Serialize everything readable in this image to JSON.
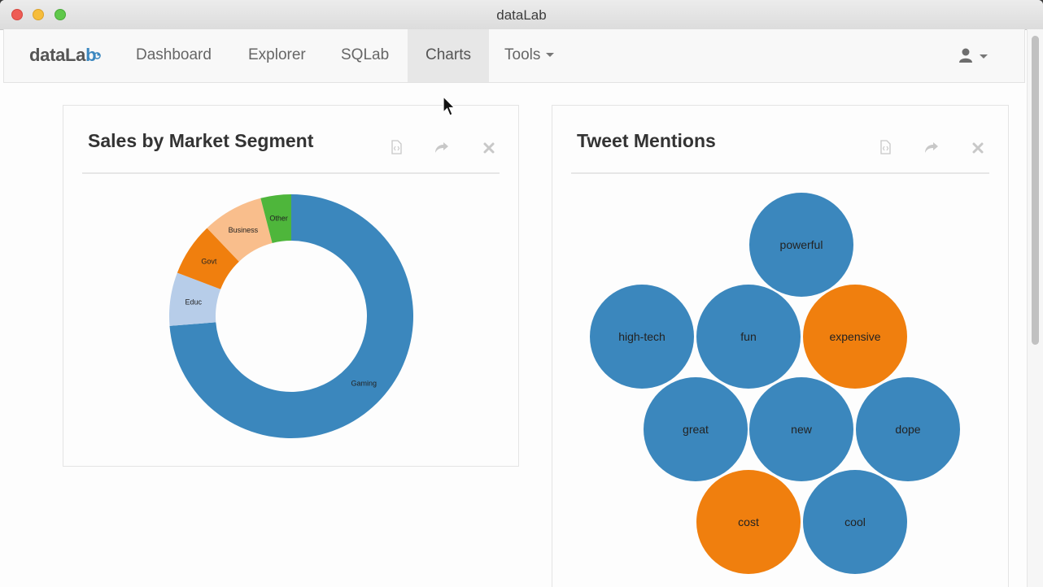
{
  "window": {
    "title": "dataLab"
  },
  "navbar": {
    "brand_main": "dataLa",
    "brand_accent": "b",
    "items": [
      {
        "label": "Dashboard"
      },
      {
        "label": "Explorer"
      },
      {
        "label": "SQLab"
      },
      {
        "label": "Charts",
        "active": true
      },
      {
        "label": "Tools",
        "dropdown": true
      }
    ],
    "user_icon": "user-icon"
  },
  "panels": {
    "sales": {
      "title": "Sales by Market Segment",
      "tools": [
        "code-file-icon",
        "share-icon",
        "close-icon"
      ]
    },
    "tweets": {
      "title": "Tweet Mentions",
      "tools": [
        "code-file-icon",
        "share-icon",
        "close-icon"
      ]
    }
  },
  "chart_data": [
    {
      "type": "pie",
      "donut": true,
      "title": "Sales by Market Segment",
      "categories": [
        "Gaming",
        "Educ",
        "Govt",
        "Business",
        "Other"
      ],
      "values": [
        73,
        7,
        7,
        8,
        4
      ],
      "colors": [
        "#3b87bd",
        "#b7cde9",
        "#f07f0e",
        "#f9be8c",
        "#4eb63b"
      ]
    },
    {
      "type": "bubble",
      "title": "Tweet Mentions",
      "categories": [
        "powerful",
        "high-tech",
        "fun",
        "expensive",
        "great",
        "new",
        "dope",
        "cost",
        "cool"
      ],
      "values": [
        1,
        1,
        1,
        1,
        1,
        1,
        1,
        1,
        1
      ],
      "groups": [
        "positive",
        "positive",
        "positive",
        "negative",
        "positive",
        "positive",
        "positive",
        "negative",
        "positive"
      ],
      "colors": {
        "positive": "#3b87bd",
        "negative": "#f07f0e"
      }
    }
  ]
}
